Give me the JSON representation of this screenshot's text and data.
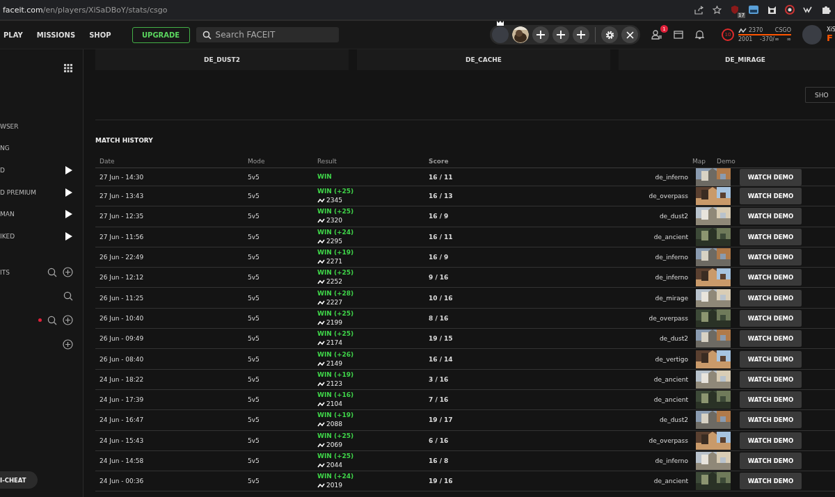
{
  "browser": {
    "url_host": "faceit.com",
    "url_path": "/en/players/XiSaDBoY/stats/csgo",
    "extension_badge": "17"
  },
  "nav": {
    "links": [
      "PLAY",
      "MISSIONS",
      "SHOP"
    ],
    "upgrade": "UPGRADE",
    "search": {
      "placeholder": "Search FACEIT"
    }
  },
  "party": [
    {
      "kind": "leader"
    },
    {
      "kind": "avatar"
    },
    {
      "kind": "add"
    },
    {
      "kind": "add"
    },
    {
      "kind": "add"
    }
  ],
  "friends_badge": "1",
  "profile": {
    "level": "10",
    "elo": "2370",
    "game": "CSGO",
    "range_low": "2001",
    "range_delta": "-370/∞",
    "range_high": "∞",
    "name": "XiS",
    "brand": "F"
  },
  "sidebar": {
    "items": [
      {
        "label": "WSER",
        "kind": "link"
      },
      {
        "label": "NG",
        "kind": "link"
      },
      {
        "label": "D",
        "kind": "submenu"
      },
      {
        "label": "D PREMIUM",
        "kind": "submenu"
      },
      {
        "label": "MAN",
        "kind": "submenu"
      },
      {
        "label": "IKED",
        "kind": "submenu"
      }
    ],
    "sections": [
      {
        "label": "ITS",
        "search": true,
        "add": true,
        "unread": false
      },
      {
        "search": true,
        "add": false,
        "unread": false
      },
      {
        "search": true,
        "add": true,
        "unread": true
      },
      {
        "search": false,
        "add": true,
        "unread": false
      }
    ],
    "anticheat": "I-CHEAT"
  },
  "map_tiles": [
    "DE_DUST2",
    "DE_CACHE",
    "DE_MIRAGE"
  ],
  "show_button": "SHO",
  "match_history": {
    "title": "MATCH HISTORY",
    "columns": [
      "Date",
      "Mode",
      "Result",
      "Score",
      "Map",
      "Demo"
    ],
    "rows": [
      {
        "date": "27 Jun - 14:30",
        "mode": "5v5",
        "result": "WIN",
        "won": true,
        "score": "16 / 11",
        "map": "de_inferno",
        "demo": "WATCH DEMO"
      },
      {
        "date": "27 Jun - 13:43",
        "mode": "5v5",
        "result": "WIN (+25)",
        "won": true,
        "elo": "2345",
        "score": "16 / 13",
        "map": "de_overpass",
        "demo": "WATCH DEMO"
      },
      {
        "date": "27 Jun - 12:35",
        "mode": "5v5",
        "result": "WIN (+25)",
        "won": true,
        "elo": "2320",
        "score": "16 / 9",
        "map": "de_dust2",
        "demo": "WATCH DEMO"
      },
      {
        "date": "27 Jun - 11:56",
        "mode": "5v5",
        "result": "WIN (+24)",
        "won": true,
        "elo": "2295",
        "score": "16 / 11",
        "map": "de_ancient",
        "demo": "WATCH DEMO"
      },
      {
        "date": "26 Jun - 22:49",
        "mode": "5v5",
        "result": "WIN (+19)",
        "won": true,
        "elo": "2271",
        "score": "16 / 9",
        "map": "de_inferno",
        "demo": "WATCH DEMO"
      },
      {
        "date": "26 Jun - 12:12",
        "mode": "5v5",
        "result": "WIN (+25)",
        "won": true,
        "elo": "2252",
        "score": "9 / 16",
        "map": "de_inferno",
        "demo": "WATCH DEMO"
      },
      {
        "date": "26 Jun - 11:25",
        "mode": "5v5",
        "result": "WIN (+28)",
        "won": true,
        "elo": "2227",
        "score": "10 / 16",
        "map": "de_mirage",
        "demo": "WATCH DEMO"
      },
      {
        "date": "26 Jun - 10:40",
        "mode": "5v5",
        "result": "WIN (+25)",
        "won": true,
        "elo": "2199",
        "score": "8 / 16",
        "map": "de_overpass",
        "demo": "WATCH DEMO"
      },
      {
        "date": "26 Jun - 09:49",
        "mode": "5v5",
        "result": "WIN (+25)",
        "won": true,
        "elo": "2174",
        "score": "19 / 15",
        "map": "de_dust2",
        "demo": "WATCH DEMO"
      },
      {
        "date": "26 Jun - 08:40",
        "mode": "5v5",
        "result": "WIN (+26)",
        "won": true,
        "elo": "2149",
        "score": "16 / 14",
        "map": "de_vertigo",
        "demo": "WATCH DEMO"
      },
      {
        "date": "24 Jun - 18:22",
        "mode": "5v5",
        "result": "WIN (+19)",
        "won": true,
        "elo": "2123",
        "score": "3 / 16",
        "map": "de_ancient",
        "demo": "WATCH DEMO"
      },
      {
        "date": "24 Jun - 17:39",
        "mode": "5v5",
        "result": "WIN (+16)",
        "won": true,
        "elo": "2104",
        "score": "7 / 16",
        "map": "de_ancient",
        "demo": "WATCH DEMO"
      },
      {
        "date": "24 Jun - 16:47",
        "mode": "5v5",
        "result": "WIN (+19)",
        "won": true,
        "elo": "2088",
        "score": "19 / 17",
        "map": "de_dust2",
        "demo": "WATCH DEMO"
      },
      {
        "date": "24 Jun - 15:43",
        "mode": "5v5",
        "result": "WIN (+25)",
        "won": true,
        "elo": "2069",
        "score": "6 / 16",
        "map": "de_overpass",
        "demo": "WATCH DEMO"
      },
      {
        "date": "24 Jun - 14:58",
        "mode": "5v5",
        "result": "WIN (+25)",
        "won": true,
        "elo": "2044",
        "score": "16 / 8",
        "map": "de_inferno",
        "demo": "WATCH DEMO"
      },
      {
        "date": "24 Jun - 00:36",
        "mode": "5v5",
        "result": "WIN (+24)",
        "won": true,
        "elo": "2019",
        "score": "19 / 16",
        "map": "de_ancient",
        "demo": "WATCH DEMO"
      }
    ]
  }
}
